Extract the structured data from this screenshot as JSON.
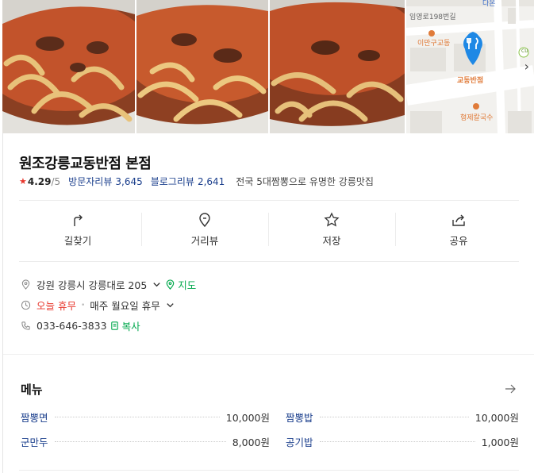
{
  "map": {
    "road_label": "임영로198번길",
    "label_top_right": "다온",
    "place_left": "이만구교동",
    "side_road": "임영로198번길",
    "selected_place": "교동반점",
    "place_bottom": "형제칼국수",
    "cu_label": "CU"
  },
  "place": {
    "name": "원조강릉교동반점 본점",
    "rating": "4.29",
    "rating_max": "/5",
    "visitor_review_label": "방문자리뷰",
    "visitor_review_count": "3,645",
    "blog_review_label": "블로그리뷰",
    "blog_review_count": "2,641",
    "description": "전국 5대짬뽕으로 유명한 강릉맛집"
  },
  "actions": [
    {
      "label": "길찾기",
      "icon": "directions-icon"
    },
    {
      "label": "거리뷰",
      "icon": "pin-icon"
    },
    {
      "label": "저장",
      "icon": "star-icon"
    },
    {
      "label": "공유",
      "icon": "share-icon"
    }
  ],
  "info": {
    "address": "강원 강릉시 강릉대로 205",
    "map_link": "지도",
    "today_status": "오늘 휴무",
    "closed_day": "매주 월요일 휴무",
    "phone": "033-646-3833",
    "copy_label": "복사"
  },
  "menu": {
    "title": "메뉴",
    "items": [
      {
        "name": "짬뽕면",
        "price": "10,000원"
      },
      {
        "name": "짬뽕밥",
        "price": "10,000원"
      },
      {
        "name": "군만두",
        "price": "8,000원"
      },
      {
        "name": "공기밥",
        "price": "1,000원"
      }
    ]
  },
  "colors": {
    "accent_blue": "#1a3e8c",
    "green": "#03a94e",
    "red": "#e8382e",
    "map_pin": "#1e88e5",
    "map_place": "#e07b39"
  }
}
